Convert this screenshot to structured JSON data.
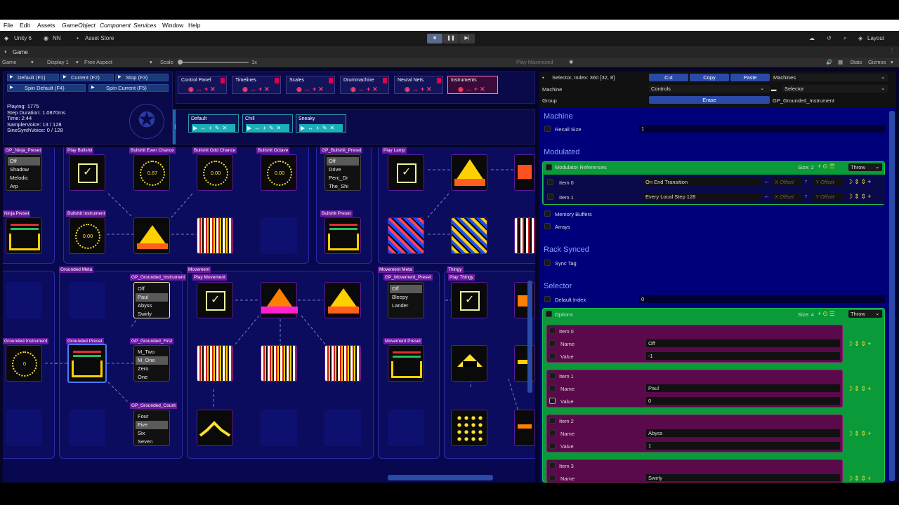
{
  "menubar": {
    "items": [
      "File",
      "Edit",
      "Assets",
      "GameObject",
      "Component",
      "Services",
      "Window",
      "Help"
    ]
  },
  "toolbar": {
    "unity": "Unity 6",
    "account": "NN",
    "store": "Asset Store",
    "layout": "Layout"
  },
  "tab": {
    "label": "Game"
  },
  "gametoolbar": {
    "display_mode": "Game",
    "display": "Display 1",
    "aspect": "Free Aspect",
    "scale_label": "Scale",
    "scale_value": "1x",
    "play_mode": "Play Maximized",
    "stats": "Stats",
    "gizmos": "Gizmos"
  },
  "left": {
    "buttons": [
      "Default (F1)",
      "Current (F2)",
      "Stop (F3)",
      "Spin Default (F4)",
      "Spin Current (F5)"
    ],
    "status": [
      "Playing: 1775",
      "Step Duration: 1.0870ms",
      "Time: 2:44",
      "SamplerVoice: 13 / 128",
      "SineSynthVoice: 0 / 128"
    ]
  },
  "tabs": [
    "Control Panel",
    "Timelines",
    "Scales",
    "Drummachine",
    "Neural Nets",
    "Instruments"
  ],
  "presets": {
    "p_label": "P",
    "items": [
      "Default",
      "Chill",
      "Sneaky"
    ]
  },
  "nodes": {
    "labels": [
      "GP_Ninja_Preset",
      "Play Bullshit",
      "Bullshit Even Chance",
      "Bullshit Odd Chance",
      "Bullshit Octave",
      "GP_Bullshit_Preset",
      "Play Lamp",
      "Ninja Preset",
      "Bullshit Instrument",
      "Bullshit Preset",
      "Grounded Meta",
      "GP_Grounded_Instrument",
      "Movement",
      "Play Movement",
      "Movement Meta",
      "Thingy",
      "GP_Movement_Preset",
      "Play Thingy",
      "Grounded Instrument",
      "Grounded Preset",
      "GP_Grounded_First",
      "Movement Preset",
      "GP_Grounded_Count"
    ],
    "knobs": [
      "0.67",
      "0.00",
      "0.00",
      "0.00",
      "0"
    ],
    "list_ninja": [
      "Off",
      "Shadow",
      "Melodic",
      "Arp"
    ],
    "list_bullshit": [
      "Off",
      "Drive",
      "Perc_Dr",
      "The_Shi"
    ],
    "list_grounded_instr": [
      "Off",
      "Paul",
      "Abyss",
      "Swirly"
    ],
    "list_movement": [
      "Off",
      "Bleepy",
      "Lander"
    ],
    "list_first": [
      "M_Two",
      "M_One",
      "Zero",
      "One"
    ],
    "list_count": [
      "Four",
      "Five",
      "Six",
      "Seven"
    ]
  },
  "inspector": {
    "title": "Selector, Index: 360 [32, 8]",
    "cut": "Cut",
    "copy": "Copy",
    "paste": "Paste",
    "machines": "Machines",
    "machine_label": "Machine",
    "machine_value": "Controls",
    "type_value": "Selector",
    "group_label": "Group",
    "erase": "Erase",
    "group_value": "GP_Grounded_Instrument",
    "sec_machine": "Machine",
    "recall_size": "Recall Size",
    "recall_size_val": "1",
    "sec_modulated": "Modulated",
    "mod_refs": "Modulator References",
    "size2": "Size: 2",
    "throw": "Throw",
    "item0": "Item 0",
    "item0_val": "On End Transition",
    "item1": "Item 1",
    "item1_val": "Every Local Step 128",
    "x_offset": "X Offset",
    "y_offset": "Y Offset",
    "memory_buffers": "Memory Buffers",
    "arrays": "Arrays",
    "sec_rack": "Rack Synced",
    "sync_tag": "Sync Tag",
    "sec_selector": "Selector",
    "default_index": "Default Index",
    "default_index_val": "0",
    "options": "Options",
    "size4": "Size: 4",
    "opt_items": [
      {
        "title": "Item 0",
        "name": "Off",
        "value": "-1"
      },
      {
        "title": "Item 1",
        "name": "Paul",
        "value": "0"
      },
      {
        "title": "Item 2",
        "name": "Abyss",
        "value": "1"
      },
      {
        "title": "Item 3",
        "name": "Swirly",
        "value": ""
      }
    ],
    "name_label": "Name",
    "value_label": "Value"
  }
}
